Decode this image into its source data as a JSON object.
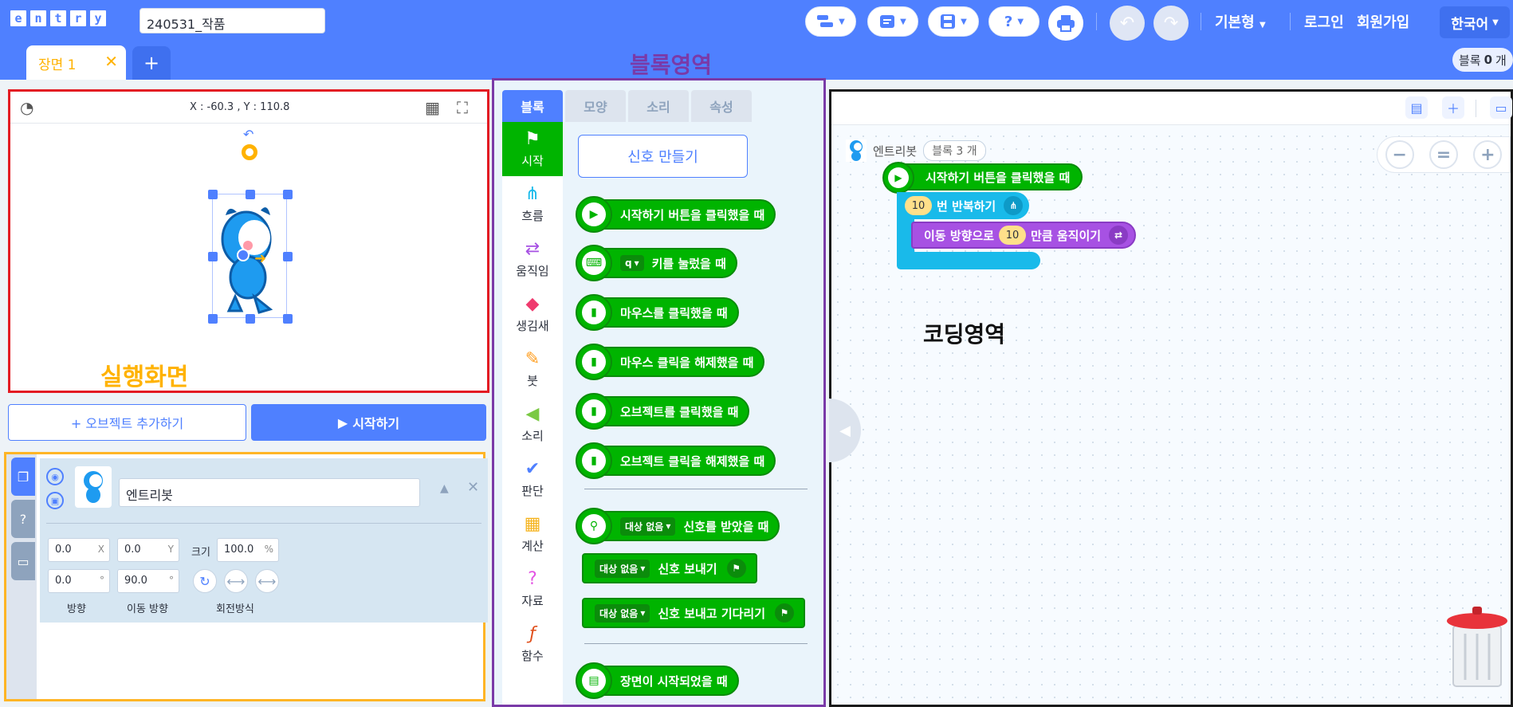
{
  "header": {
    "logo_letters": [
      "e",
      "n",
      "t",
      "r",
      "y"
    ],
    "project_title": "240531_작품",
    "mode_label": "기본형",
    "login_label": "로그인",
    "signup_label": "회원가입",
    "language_label": "한국어",
    "block_count_prefix": "블록",
    "block_count_value": "0",
    "block_count_suffix": "개",
    "brand_color": "#4f80ff"
  },
  "scene": {
    "tab_label": "장면 1",
    "close_glyph": "✕",
    "add_glyph": "+"
  },
  "stage": {
    "coords": "X : -60.3 , Y : 110.8",
    "annotation": "실행화면",
    "annotation_color": "#ffb200"
  },
  "actions": {
    "add_object": "+ 오브젝트 추가하기",
    "start": "시작하기"
  },
  "object": {
    "name": "엔트리봇",
    "x": "0.0",
    "x_suffix": "X",
    "y": "0.0",
    "y_suffix": "Y",
    "size_label": "크기",
    "size": "100.0",
    "size_suffix": "%",
    "direction": "0.0",
    "move_direction": "90.0",
    "degree_suffix": "°",
    "direction_label": "방향",
    "move_direction_label": "이동 방향",
    "rotation_label": "회전방식"
  },
  "palette": {
    "annotation": "블록영역",
    "annotation_color": "#7a3aa8",
    "tabs": [
      "블록",
      "모양",
      "소리",
      "속성"
    ],
    "categories": [
      "시작",
      "흐름",
      "움직임",
      "생김새",
      "붓",
      "소리",
      "판단",
      "계산",
      "자료",
      "함수"
    ],
    "signal_button": "신호 만들기",
    "blocks": {
      "b1": "시작하기 버튼을 클릭했을 때",
      "b2_key": "q",
      "b2": "키를 눌렀을 때",
      "b3": "마우스를 클릭했을 때",
      "b4": "마우스 클릭을 해제했을 때",
      "b5": "오브젝트를 클릭했을 때",
      "b6": "오브젝트 클릭을 해제했을 때",
      "none": "대상 없음",
      "b7": "신호를 받았을 때",
      "b8": "신호 보내기",
      "b9": "신호 보내고 기다리기",
      "b10": "장면이 시작되었을 때"
    }
  },
  "code": {
    "annotation": "코딩영역",
    "object_name": "엔트리봇",
    "block_count": "블록 3 개",
    "script": {
      "when_start": "시작하기 버튼을 클릭했을 때",
      "repeat_count": "10",
      "repeat_label": "번 반복하기",
      "move_prefix": "이동 방향으로",
      "move_value": "10",
      "move_suffix": "만큼 움직이기"
    },
    "colors": {
      "start": "#00b400",
      "flow": "#19baea",
      "move": "#a751e3"
    }
  }
}
